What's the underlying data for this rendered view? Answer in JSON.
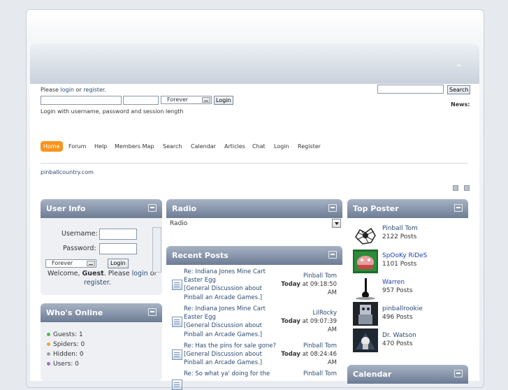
{
  "header": {
    "login_prompt_pre": "Please ",
    "login_link": "login",
    "login_prompt_mid": " or ",
    "register_link": "register",
    "login_prompt_end": ".",
    "session_select": "Forever",
    "login_button": "Login",
    "hint": "Login with username, password and session length",
    "search_button": "Search",
    "news_label": "News:",
    "upshrink_glyph": "⌃"
  },
  "menu": {
    "items": [
      "Home",
      "Forum",
      "Help",
      "Members Map",
      "Search",
      "Calendar",
      "Articles",
      "Chat",
      "Login",
      "Register"
    ]
  },
  "breadcrumb": {
    "site": "pinballcountry.com"
  },
  "user_info": {
    "title": "User Info",
    "username_label": "Username:",
    "password_label": "Password:",
    "session_select": "Forever",
    "login_button": "Login",
    "welcome_pre": "Welcome, ",
    "guest": "Guest",
    "welcome_mid": ". Please ",
    "login_link": "login",
    "or": " or",
    "register_link": "register",
    "end": "."
  },
  "whos_online": {
    "title": "Who's Online",
    "rows": [
      {
        "label": "Guests: 1",
        "color": "#57b35a"
      },
      {
        "label": "Spiders: 0",
        "color": "#f2a23c"
      },
      {
        "label": "Hidden: 0",
        "color": "#9aa0aa"
      },
      {
        "label": "Users: 0",
        "color": "#a46ad0"
      }
    ]
  },
  "radio": {
    "title": "Radio",
    "select_value": "Radio"
  },
  "recent_posts": {
    "title": "Recent Posts",
    "posts": [
      {
        "l1": "Re: Indiana Jones Mine Cart",
        "l2": "Easter Egg",
        "l3": "[General Discussion about",
        "l4": "Pinball an Arcade Games.]",
        "author": "Pinball Tom",
        "day": "Today",
        "at": " at 09:18:50",
        "ampm": "AM"
      },
      {
        "l1": "Re: Indiana Jones Mine Cart",
        "l2": "Easter Egg",
        "l3": "[General Discussion about",
        "l4": "Pinball an Arcade Games.]",
        "author": "LilRocky",
        "day": "Today",
        "at": " at 09:07:39",
        "ampm": "AM"
      },
      {
        "l1": "Re: Has the pins for sale gone?",
        "l2": "[General Discussion about",
        "l3": "Pinball an Arcade Games.]",
        "l4": "",
        "author": "Pinball Tom",
        "day": "Today",
        "at": " at 08:24:46",
        "ampm": "AM"
      },
      {
        "l1": "Re: So what ya' doing for the",
        "l2": "",
        "l3": "",
        "l4": "",
        "author": "Pinball Tom",
        "day": "",
        "at": "",
        "ampm": ""
      }
    ]
  },
  "top_poster": {
    "title": "Top Poster",
    "users": [
      {
        "name": "Pinball Tom",
        "posts": "2122 Posts"
      },
      {
        "name": "SpOoKy RiDeS",
        "posts": "1101 Posts"
      },
      {
        "name": "Warren",
        "posts": "957 Posts"
      },
      {
        "name": "pinballrookie",
        "posts": "496 Posts"
      },
      {
        "name": "Dr. Watson",
        "posts": "470 Posts"
      }
    ]
  },
  "calendar": {
    "title": "Calendar"
  }
}
